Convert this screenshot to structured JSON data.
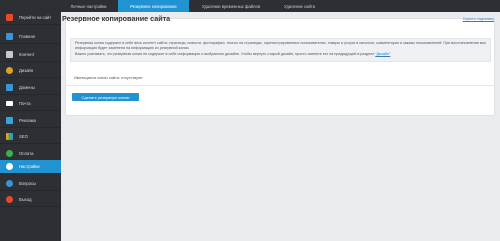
{
  "sidebar": {
    "items": [
      {
        "label": "Перейти на сайт",
        "icon": "home-icon",
        "color": "#e8492b"
      },
      {
        "label": "Главная",
        "icon": "dashboard-icon",
        "color": "#3a95d6"
      },
      {
        "label": "Контент",
        "icon": "content-icon",
        "color": "#c8c8c8"
      },
      {
        "label": "Дизайн",
        "icon": "design-icon",
        "color": "#e0a020"
      },
      {
        "label": "Домены",
        "icon": "domains-icon",
        "color": "#3a95d6"
      },
      {
        "label": "Почта",
        "icon": "mail-icon",
        "color": "#ffffff"
      },
      {
        "label": "Реклама",
        "icon": "megaphone-icon",
        "color": "#3aa0e0"
      },
      {
        "label": "SEO",
        "icon": "seo-chart-icon",
        "color": "#e0a020"
      },
      {
        "label": "Оплата",
        "icon": "payment-icon",
        "color": "#38b24a"
      },
      {
        "label": "Настройки",
        "icon": "settings-gear-icon",
        "color": "#ffffff"
      },
      {
        "label": "Вопросы",
        "icon": "help-icon",
        "color": "#3a95d6"
      },
      {
        "label": "Выход",
        "icon": "logout-icon",
        "color": "#e8492b"
      }
    ],
    "active_index": 9
  },
  "tabs": [
    {
      "label": "Личные настройки"
    },
    {
      "label": "Резервное копирование"
    },
    {
      "label": "Удаление временных файлов"
    },
    {
      "label": "Удаление сайта"
    }
  ],
  "active_tab_index": 1,
  "page": {
    "title": "Резервное копирование сайта",
    "hide_hint": "Скрыть подсказку",
    "info_line1": "Резервная копия содержит в себе весь контент сайта: страницы, новости, фотографии, тексты на страницах, зарегистрированных пользователях, товары и услуги в каталоге, комментарии и заказы пользователей. При восстановлении вся информация будет заменена на информацию из резервной копии.",
    "info_line2": "Важно учитывать, что резервная копия не содержит в себе информацию о выбранном дизайне. Чтобы вернуть старый дизайн, просто смените его на предыдущий в разделе",
    "info_link": "\"Дизайн\"",
    "no_copies": "Имеющиеся копии сайта: отсутствуют",
    "create_button": "Сделать резервную копию"
  },
  "colors": {
    "accent": "#2193d1",
    "sidebar_bg": "#2c2f33"
  }
}
